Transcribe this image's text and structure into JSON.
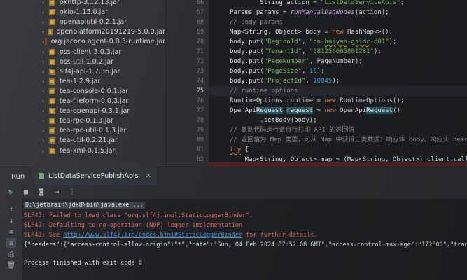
{
  "project_tree": {
    "items": [
      {
        "label": "okhttp-3.12.13.jar",
        "icon": "jar-icon"
      },
      {
        "label": "okio-1.15.0.jar",
        "icon": "jar-icon"
      },
      {
        "label": "openapiutil-0.2.1.jar",
        "icon": "jar-icon"
      },
      {
        "label": "openplatform20191219-5.0.0.jar",
        "icon": "jar-icon"
      },
      {
        "label": "org.jacoco.agent-0.8.3-runtime.jar",
        "icon": "jar-icon"
      },
      {
        "label": "oss-client-3.0.3.jar",
        "icon": "jar-icon"
      },
      {
        "label": "oss-util-1.0.2.jar",
        "icon": "jar-icon"
      },
      {
        "label": "slf4j-api-1.7.36.jar",
        "icon": "jar-icon"
      },
      {
        "label": "tea-1.2.9.jar",
        "icon": "jar-icon"
      },
      {
        "label": "tea-console-0.0.1.jar",
        "icon": "jar-icon"
      },
      {
        "label": "tea-fileform-0.0.3.jar",
        "icon": "jar-icon"
      },
      {
        "label": "tea-openapi-0.3.1.jar",
        "icon": "jar-icon"
      },
      {
        "label": "tea-rpc-0.1.3.jar",
        "icon": "jar-icon"
      },
      {
        "label": "tea-rpc-util-0.1.3.jar",
        "icon": "jar-icon"
      },
      {
        "label": "tea-util-0.2.21.jar",
        "icon": "jar-icon"
      },
      {
        "label": "tea-xml-0.1.5.jar",
        "icon": "jar-icon"
      }
    ]
  },
  "editor": {
    "line_numbers": [
      "66",
      "67",
      "68",
      "69",
      "70",
      "71",
      "72",
      "73",
      "74",
      "75",
      "76",
      "77",
      "78",
      "79",
      "80",
      "81",
      "82"
    ],
    "active_line": "75"
  },
  "run_panel": {
    "title": "Run",
    "tab_label": "ListDataServicePublishApis",
    "console_lines": {
      "cmd": "D:\\jetbrain\\jdk8\\bin\\java.exe ...",
      "l1": "SLF4J: Failed to load class \"org.slf4j.impl.StaticLoggerBinder\".",
      "l2": "SLF4J: Defaulting to no-operation (NOP) logger implementation",
      "l3_prefix": "SLF4J: See ",
      "l3_link": "http://www.slf4j.org/codes.html#StaticLoggerBinder",
      "l3_suffix": " for further details.",
      "l4": "{\"headers\":{\"access-control-allow-origin\":\"*\",\"date\":\"Sun, 04 Feb 2024 07:52:08 GMT\",\"access-control-max-age\":\"172800\",\"transfe",
      "l5": "Process finished with exit code 0"
    }
  }
}
